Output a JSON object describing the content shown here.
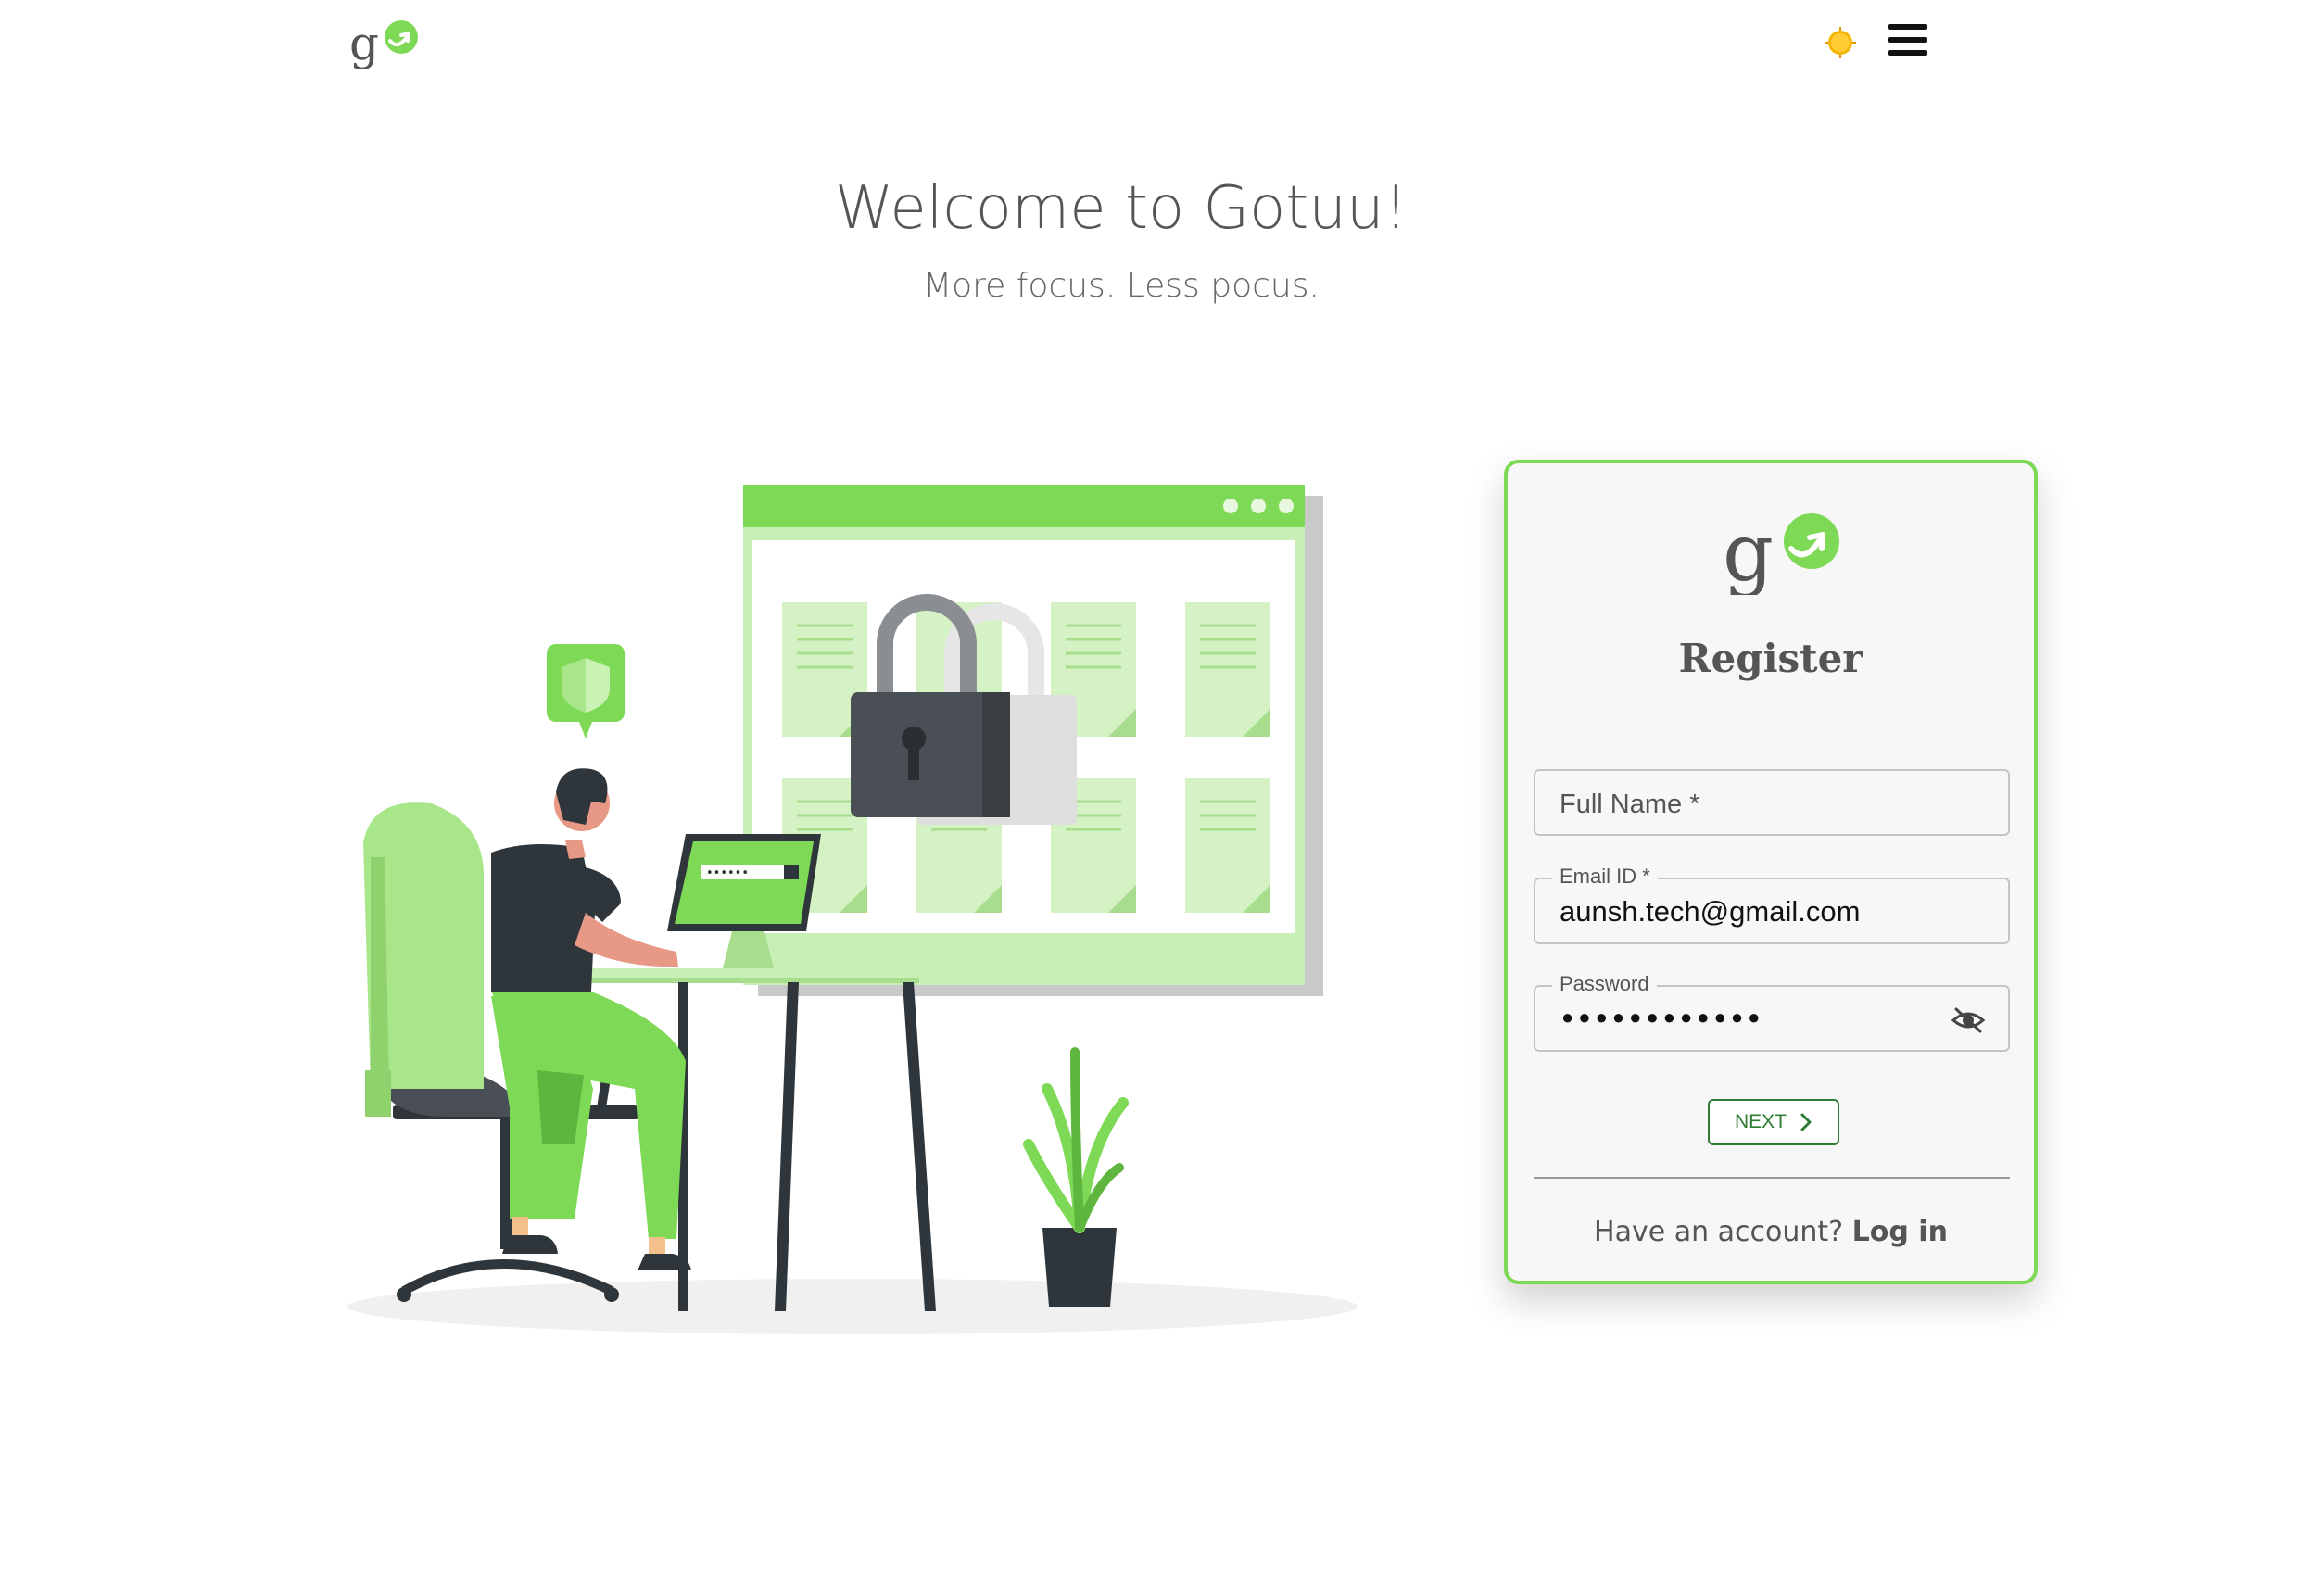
{
  "header": {
    "logo_alt": "Gotuu",
    "theme_toggle_icon": "sun-icon",
    "menu_icon": "hamburger-menu-icon"
  },
  "hero": {
    "title": "Welcome to Gotuu!",
    "subtitle": "More focus. Less pocus."
  },
  "illustration": {
    "laptop_password_dots": "••••••"
  },
  "register_card": {
    "title": "Register",
    "full_name": {
      "placeholder": "Full Name *",
      "value": ""
    },
    "email": {
      "label": "Email ID *",
      "value": "aunsh.tech@gmail.com"
    },
    "password": {
      "label": "Password",
      "masked_value": "●●●●●●●●●●●●",
      "toggle_icon": "eye-off-icon"
    },
    "next_button": "NEXT",
    "login_prompt": "Have an account?",
    "login_link": "Log in"
  },
  "colors": {
    "brand_green": "#7ed957",
    "button_green": "#2e7d32",
    "text_gray": "#555555"
  }
}
